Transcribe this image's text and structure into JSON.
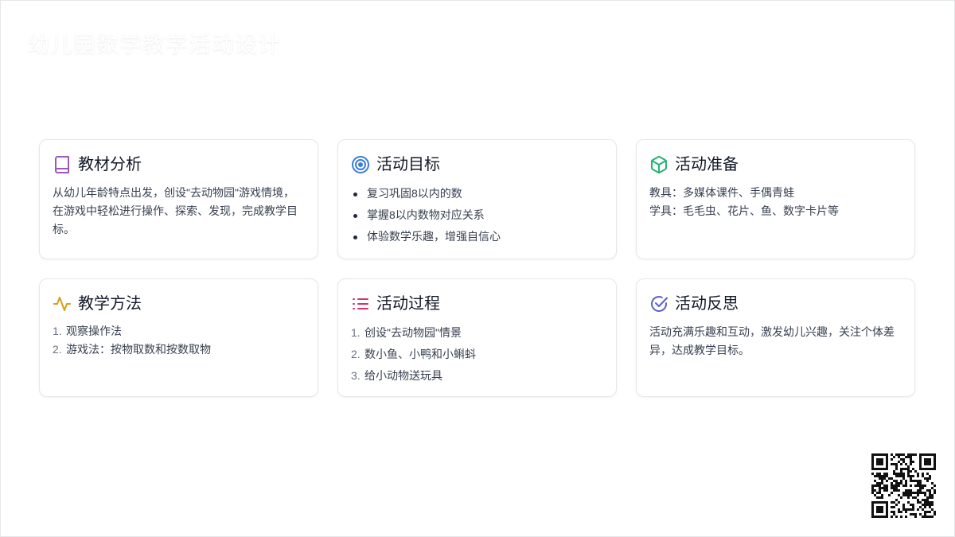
{
  "page": {
    "title": "幼儿园数学教学活动设计"
  },
  "colors": {
    "purple": "#9b59b6",
    "blue": "#3b7dd8",
    "green": "#22b573",
    "yellow": "#d4a017",
    "pink": "#d6336c",
    "indigo": "#5b5fc7"
  },
  "cards": [
    {
      "icon": "book-icon",
      "title": "教材分析",
      "text": "从幼儿年龄特点出发，创设\"去动物园\"游戏情境，在游戏中轻松进行操作、探索、发现，完成教学目标。"
    },
    {
      "icon": "target-icon",
      "title": "活动目标",
      "items": [
        "复习巩固8以内的数",
        "掌握8以内数物对应关系",
        "体验数学乐趣，增强自信心"
      ]
    },
    {
      "icon": "package-icon",
      "title": "活动准备",
      "lines": [
        "教具：多媒体课件、手偶青蛙",
        "学具：毛毛虫、花片、鱼、数字卡片等"
      ]
    },
    {
      "icon": "activity-icon",
      "title": "教学方法",
      "items": [
        "观察操作法",
        "游戏法：按物取数和按数取物"
      ]
    },
    {
      "icon": "list-icon",
      "title": "活动过程",
      "items": [
        "创设\"去动物园\"情景",
        "数小鱼、小鸭和小蝌蚪",
        "给小动物送玩具"
      ]
    },
    {
      "icon": "check-circle-icon",
      "title": "活动反思",
      "text": "活动充满乐趣和互动，激发幼儿兴趣，关注个体差异，达成教学目标。"
    }
  ],
  "numbers": [
    "1.",
    "2.",
    "3."
  ]
}
